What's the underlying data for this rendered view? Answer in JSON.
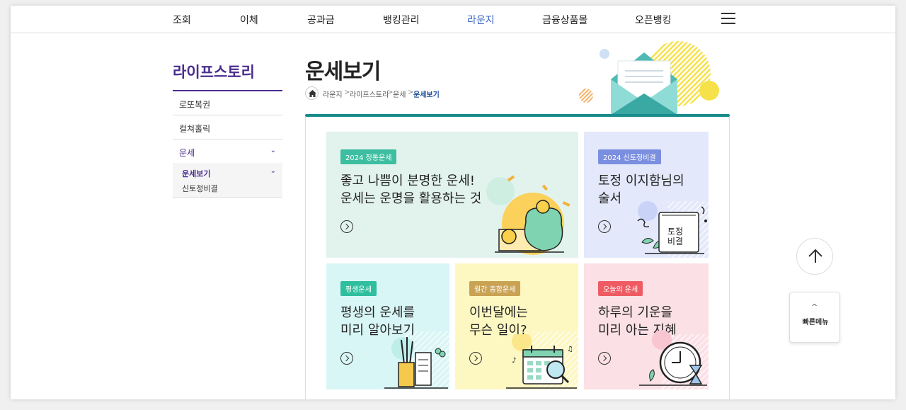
{
  "gnb": {
    "items": [
      "조회",
      "이체",
      "공과금",
      "뱅킹관리",
      "라운지",
      "금융상품몰",
      "오픈뱅킹"
    ],
    "active": "라운지"
  },
  "lnb": {
    "title": "라이프스토리",
    "items": [
      "로또복권",
      "컬쳐홀릭",
      "운세"
    ],
    "sub_items": [
      "운세보기",
      "신토정비결"
    ]
  },
  "page": {
    "title": "운세보기",
    "breadcrumb": [
      "라운지",
      "라이프스토리",
      "운세",
      "운세보기"
    ]
  },
  "cards": [
    {
      "badge": "2024 정통운세",
      "line1": "좋고 나쁨이 분명한 운세!",
      "line2": "운세는 운명을 활용하는 것",
      "bg": "#e2f3ee",
      "badge_color": "#3dbea0"
    },
    {
      "badge": "2024 신토정비결",
      "line1": "토정 이지함님의",
      "line2": "술서",
      "bg": "#e3e8fb",
      "badge_color": "#7b8fe0"
    },
    {
      "badge": "평생운세",
      "line1": "평생의 운세를",
      "line2": "미리 알아보기",
      "bg": "#d9f6f6",
      "badge_color": "#2fbe9e"
    },
    {
      "badge": "월간 종합운세",
      "line1": "이번달에는",
      "line2": "무슨 일이?",
      "bg": "#fdf7c2",
      "badge_color": "#c9a254"
    },
    {
      "badge": "오늘의 운세",
      "line1": "하루의 기운을",
      "line2": "미리 아는 지혜",
      "bg": "#fbe0e6",
      "badge_color": "#ef5b63"
    }
  ],
  "card_art": {
    "seal_line1": "토정",
    "seal_line2": "비결"
  },
  "quick_menu": {
    "label": "빠른메뉴"
  },
  "colors": {
    "accent": "#4a2d8f",
    "teal": "#1a8c8c",
    "active_nav": "#3a66c4"
  }
}
